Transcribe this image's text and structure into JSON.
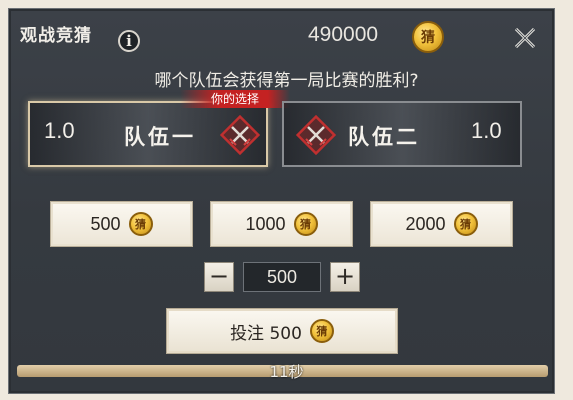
{
  "header": {
    "title": "观战竞猜",
    "info_icon": "info-icon",
    "balance": "490000",
    "coin_glyph": "猜",
    "close_icon": "close-icon"
  },
  "question": "哪个队伍会获得第一局比赛的胜利?",
  "teams": [
    {
      "name": "队伍一",
      "odds": "1.0",
      "selected": true,
      "icon": "crossed-swords-icon"
    },
    {
      "name": "队伍二",
      "odds": "1.0",
      "selected": false,
      "icon": "crossed-swords-icon"
    }
  ],
  "choice_tag": "你的选择",
  "bet_options": [
    {
      "label": "500"
    },
    {
      "label": "1000"
    },
    {
      "label": "2000"
    }
  ],
  "stepper": {
    "minus": "−",
    "value": "500",
    "plus": "+"
  },
  "submit_label": "投注 500",
  "timer": {
    "label": "11秒",
    "progress": 1.0
  },
  "colors": {
    "panel": "#3a3f45",
    "selected_border": "#d9c9a8",
    "tag_red": "#c42222",
    "coin_gold": "#f2c23c",
    "button_bg": "#f6f2e9"
  }
}
